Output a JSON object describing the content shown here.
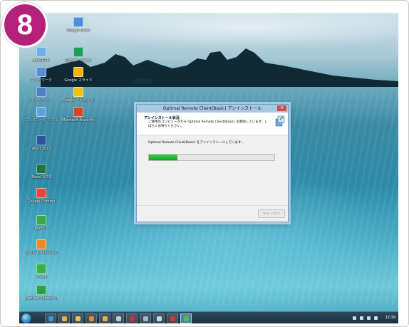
{
  "step_badge": "8",
  "desktop_icons": [
    {
      "label": "Google Drive",
      "icon": "google-drive-icon",
      "color": "#4a8fe0"
    },
    {
      "label": "Boxの共有",
      "icon": "recycle-bin-icon",
      "color": "#6db0e8"
    },
    {
      "label": "Google Sheets",
      "icon": "google-sheets-icon",
      "color": "#1f9d55"
    },
    {
      "label": "ネットワーク",
      "icon": "network-icon",
      "color": "#5a8fd8"
    },
    {
      "label": "Google スライド",
      "icon": "google-slides-icon",
      "color": "#f4b400"
    },
    {
      "label": "ネットワーク",
      "icon": "network-icon",
      "color": "#4f7fc9"
    },
    {
      "label": "Google ドキュメント",
      "icon": "google-docs-icon",
      "color": "#f4c20d"
    },
    {
      "label": "コントロール パネル",
      "icon": "control-panel-icon",
      "color": "#5ba3e0"
    },
    {
      "label": "Microsoft PowerPoint ...",
      "icon": "powerpoint-icon",
      "color": "#d24726"
    },
    {
      "label": "Word 2013",
      "icon": "word-icon",
      "color": "#2b579a"
    },
    {
      "label": "Excel 2013",
      "icon": "excel-icon",
      "color": "#217346"
    },
    {
      "label": "Google Chrome",
      "icon": "chrome-icon",
      "color": "#e8453c"
    },
    {
      "label": "WinSCP",
      "icon": "winscp-icon",
      "color": "#3aa84a"
    },
    {
      "label": "Optimal Remote CopyPlayer",
      "icon": "optimal-remote-icon",
      "color": "#e88a2a"
    },
    {
      "label": "ごみ箱",
      "icon": "remote-client-icon",
      "color": "#3cb04a"
    },
    {
      "label": "Optimal Remote Operator(Basic)",
      "icon": "optimal-operator-icon",
      "color": "#2fa04a"
    }
  ],
  "dialog": {
    "title": "Optimal Remote Client(Basic) アンインストール",
    "close": "✕",
    "heading": "アンインストール状況",
    "subtext": "ご使用のコンピュータから Optimal Remote Client(Basic) を削除しています。しばらくお待ちください。",
    "status": "Optimal Remote Client(Basic) をアンインストールしています...",
    "progress_percent": 23,
    "cancel_label": "キャンセル"
  },
  "taskbar": {
    "buttons": [
      {
        "icon": "ie-icon",
        "color": "#3a9ad9"
      },
      {
        "icon": "chrome-icon",
        "color": "#e8b23c"
      },
      {
        "icon": "explorer-icon",
        "color": "#e6c65c"
      },
      {
        "icon": "media-player-icon",
        "color": "#f08a24"
      },
      {
        "icon": "app-icon",
        "color": "#e0b050"
      },
      {
        "icon": "app-icon",
        "color": "#c9c9c9"
      },
      {
        "icon": "record-icon",
        "color": "#d03030"
      },
      {
        "icon": "app-icon",
        "color": "#9bb8cc"
      },
      {
        "icon": "app-icon",
        "color": "#cfd8de"
      },
      {
        "icon": "pdf-icon",
        "color": "#d33a2c"
      },
      {
        "icon": "installer-icon",
        "color": "#4cc04a"
      }
    ],
    "clock": "12:39"
  }
}
